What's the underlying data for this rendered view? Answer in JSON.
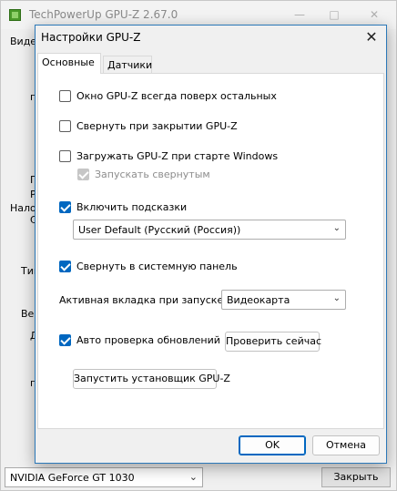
{
  "main_window": {
    "title": "TechPowerUp GPU-Z 2.67.0",
    "tab_partial": "Виде",
    "side_fragments": [
      "п",
      "П",
      "Р",
      "Нало",
      "С",
      "Тип",
      "Вер",
      "Д",
      "п"
    ],
    "gpu_select": {
      "value": "NVIDIA GeForce GT 1030"
    },
    "close_button": "Закрыть"
  },
  "dialog": {
    "title": "Настройки GPU-Z",
    "tabs": [
      {
        "label": "Основные",
        "active": true
      },
      {
        "label": "Датчики",
        "active": false
      }
    ],
    "options": {
      "always_on_top": {
        "label": "Окно GPU-Z всегда поверх остальных",
        "checked": false
      },
      "minimize_on_close": {
        "label": "Свернуть при закрытии GPU-Z",
        "checked": false
      },
      "load_on_startup": {
        "label": "Загружать GPU-Z при старте Windows",
        "checked": false
      },
      "start_minimized": {
        "label": "Запускать свернутым",
        "checked": true,
        "disabled": true
      },
      "enable_tooltips": {
        "label": "Включить подсказки",
        "checked": true
      },
      "minimize_to_tray": {
        "label": "Свернуть в системную панель",
        "checked": true
      },
      "auto_update": {
        "label": "Авто проверка обновлений",
        "checked": true
      }
    },
    "language_select": {
      "value": "User Default (Русский (Россия))"
    },
    "active_tab_label": "Активная вкладка при запуске:",
    "active_tab_select": {
      "value": "Видеокарта"
    },
    "check_now_button": "Проверить сейчас",
    "run_installer_button": "Запустить установщик GPU-Z",
    "ok_button": "OK",
    "cancel_button": "Отмена"
  },
  "colors": {
    "accent": "#0067c0",
    "dialog_border": "#2b78b8"
  }
}
